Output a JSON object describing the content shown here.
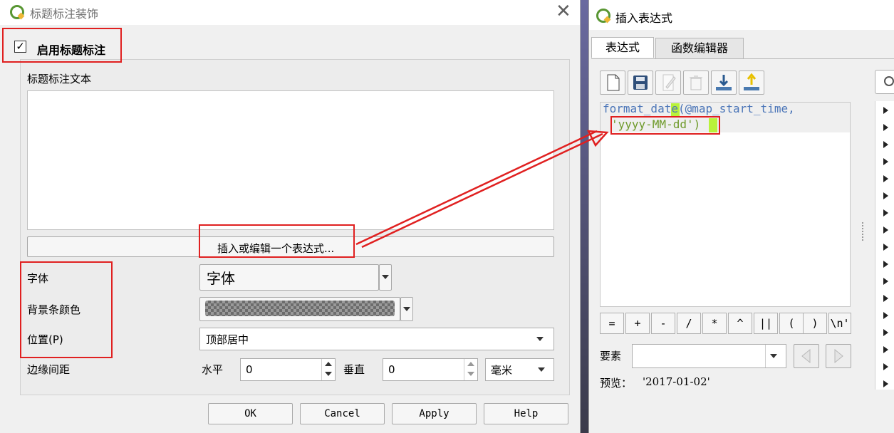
{
  "left_dialog": {
    "title": "标题标注装饰",
    "enable_label": "启用标题标注",
    "enable_checked": "✓",
    "text_label": "标题标注文本",
    "text_value": "",
    "insert_expression_button": "插入或编辑一个表达式...",
    "font_label": "字体",
    "font_value": "字体",
    "bg_color_label": "背景条颜色",
    "position_label": "位置(P)",
    "position_value": "顶部居中",
    "margin_label": "边缘间距",
    "horizontal_label": "水平",
    "horizontal_value": "0",
    "vertical_label": "垂直",
    "vertical_value": "0",
    "unit_value": "毫米",
    "buttons": {
      "ok": "OK",
      "cancel": "Cancel",
      "apply": "Apply",
      "help": "Help"
    }
  },
  "right_dialog": {
    "title": "插入表达式",
    "tabs": [
      "表达式",
      "函数编辑器"
    ],
    "expression_line1": "format_date(@map_start_time,",
    "expression_line2": "'yyyy-MM-dd')",
    "operators": [
      "=",
      "+",
      "-",
      "/",
      "*",
      "^",
      "||",
      "(",
      ")",
      "\\n'"
    ],
    "feature_label": "要素",
    "preview_label": "预览：",
    "preview_value": "'2017-01-02'"
  },
  "colors": {
    "annotation_red": "#e02020",
    "code_blue": "#4c76b8",
    "code_string": "#6e9a2a",
    "bracket_highlight": "#b9f23a",
    "qgis_green": "#589632",
    "qgis_yellow": "#eeb735"
  },
  "icons": [
    "qgis-logo-icon",
    "close-icon",
    "new-file-icon",
    "save-icon",
    "edit-icon",
    "delete-icon",
    "import-icon",
    "export-icon",
    "search-icon",
    "chevron-down-icon",
    "prev-arrow-icon",
    "next-arrow-icon",
    "tree-expand-icon"
  ]
}
